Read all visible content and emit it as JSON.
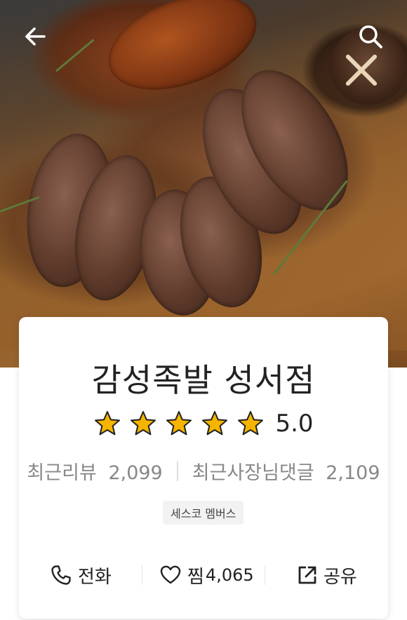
{
  "header": {
    "back_icon": "back-arrow-icon",
    "search_icon": "search-icon"
  },
  "store": {
    "name": "감성족발 성서점",
    "rating": "5.0",
    "stars": 5,
    "recent_reviews_label": "최근리뷰",
    "recent_reviews_count": "2,099",
    "owner_replies_label": "최근사장님댓글",
    "owner_replies_count": "2,109",
    "badge": "세스코 멤버스"
  },
  "actions": {
    "call_label": "전화",
    "favorite_label": "찜",
    "favorite_count": "4,065",
    "share_label": "공유"
  },
  "colors": {
    "star": "#f5b400",
    "text_primary": "#222222",
    "text_secondary": "#888888"
  }
}
